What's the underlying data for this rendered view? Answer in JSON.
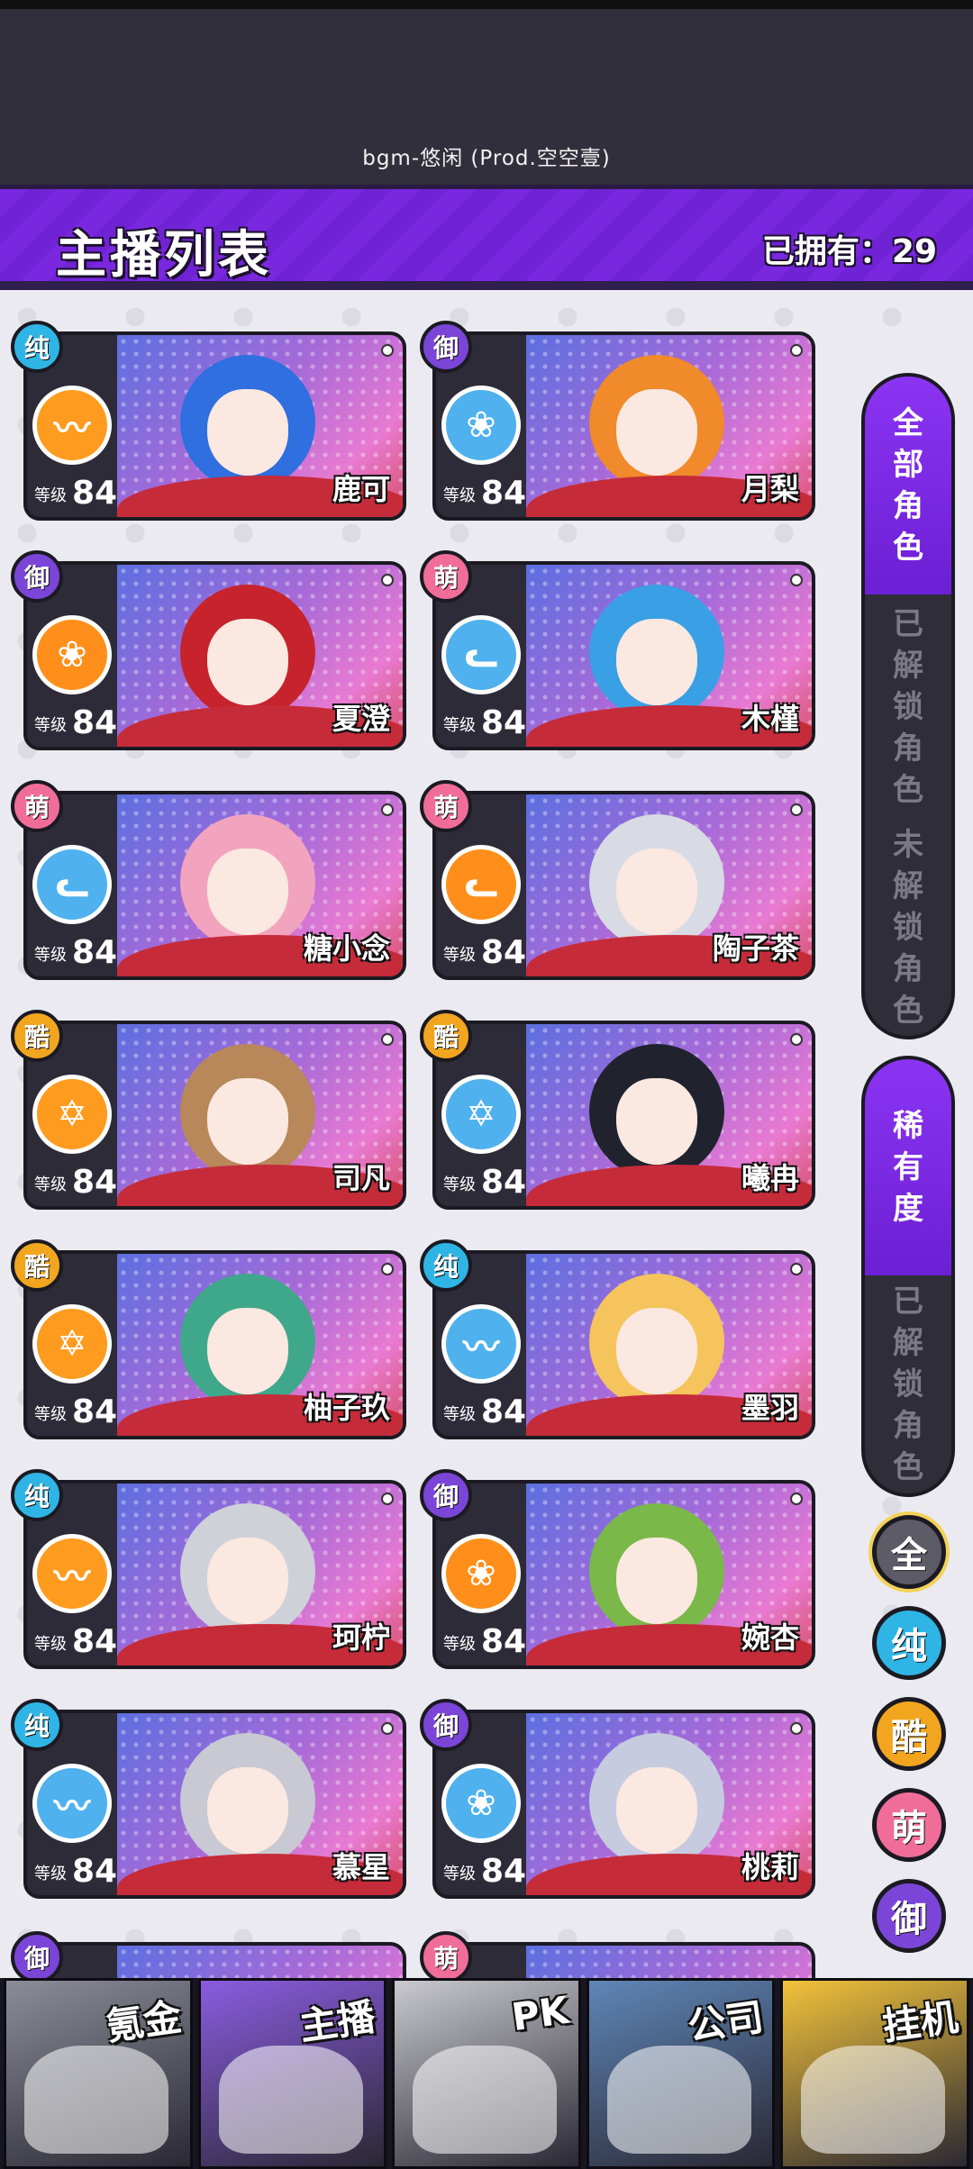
{
  "music": "bgm-悠闲 (Prod.空空壹)",
  "header": {
    "title": "主播列表",
    "owned_text": "已拥有：29"
  },
  "level_label": "等级",
  "types": {
    "纯": "#2fb4e6",
    "御": "#7b45d8",
    "萌": "#f06d9a",
    "酷": "#f2a61f"
  },
  "cards": [
    {
      "name": "鹿可",
      "type": "纯",
      "level": "84",
      "icon": "heartbeat-icon",
      "element_color": "#ff9b1e",
      "hair": "#2f6fe0"
    },
    {
      "name": "月梨",
      "type": "御",
      "level": "84",
      "icon": "rose-icon",
      "element_color": "#4fb1ee",
      "hair": "#f08a2a"
    },
    {
      "name": "夏澄",
      "type": "御",
      "level": "84",
      "icon": "rose-icon",
      "element_color": "#ff8f1a",
      "hair": "#c6232c"
    },
    {
      "name": "木槿",
      "type": "萌",
      "level": "84",
      "icon": "cat-icon",
      "element_color": "#4fb1ee",
      "hair": "#3aa0e6"
    },
    {
      "name": "糖小念",
      "type": "萌",
      "level": "84",
      "icon": "cat-icon",
      "element_color": "#4fb1ee",
      "hair": "#f2a4be"
    },
    {
      "name": "陶子茶",
      "type": "萌",
      "level": "84",
      "icon": "cat-icon",
      "element_color": "#ff8f1a",
      "hair": "#d9dbe4"
    },
    {
      "name": "司凡",
      "type": "酷",
      "level": "84",
      "icon": "star-icon",
      "element_color": "#ff9b1e",
      "hair": "#b8875a"
    },
    {
      "name": "曦冉",
      "type": "酷",
      "level": "84",
      "icon": "star-icon",
      "element_color": "#4fb1ee",
      "hair": "#20232e"
    },
    {
      "name": "柚子玖",
      "type": "酷",
      "level": "84",
      "icon": "star-icon",
      "element_color": "#ff9b1e",
      "hair": "#3fa88b"
    },
    {
      "name": "墨羽",
      "type": "纯",
      "level": "84",
      "icon": "heartbeat-icon",
      "element_color": "#4fb1ee",
      "hair": "#f5c45c"
    },
    {
      "name": "珂柠",
      "type": "纯",
      "level": "84",
      "icon": "heartbeat-icon",
      "element_color": "#ff9b1e",
      "hair": "#cfd1d8"
    },
    {
      "name": "婉杏",
      "type": "御",
      "level": "84",
      "icon": "rose-icon",
      "element_color": "#ff8f1a",
      "hair": "#7bb84a"
    },
    {
      "name": "慕星",
      "type": "纯",
      "level": "84",
      "icon": "heartbeat-icon",
      "element_color": "#4fb1ee",
      "hair": "#c8c9d2"
    },
    {
      "name": "桃莉",
      "type": "御",
      "level": "84",
      "icon": "rose-icon",
      "element_color": "#4fb1ee",
      "hair": "#c6cbe0"
    }
  ],
  "partial_badges": [
    "御",
    "萌"
  ],
  "filter_all": {
    "active": "全部角色",
    "unlocked": "已解锁角色",
    "locked": "未解锁角色"
  },
  "filter_rarity": {
    "active": "稀有度",
    "unlocked": "已解锁角色"
  },
  "type_buttons": [
    "全",
    "纯",
    "酷",
    "萌",
    "御"
  ],
  "bottom_nav": [
    "氪金",
    "主播",
    "PK",
    "公司",
    "挂机"
  ]
}
